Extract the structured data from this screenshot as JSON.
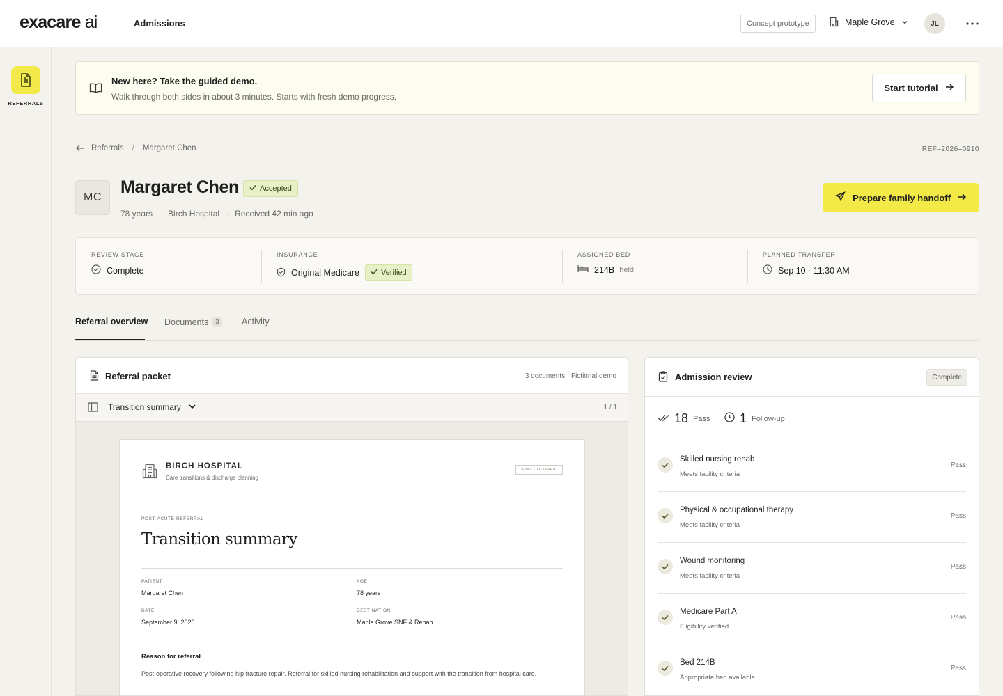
{
  "header": {
    "logo_main": "exacare",
    "logo_suffix": " ai",
    "section": "Admissions",
    "concept_label": "Concept prototype",
    "facility": "Maple Grove",
    "user_initials": "JL"
  },
  "sidebar": {
    "items": [
      {
        "label": "REFERRALS",
        "icon": "document-icon",
        "active": true
      }
    ],
    "accent": "#f2ea4a"
  },
  "banner": {
    "title": "New here? Take the guided demo.",
    "subtitle": "Walk through both sides in about 3 minutes. Starts with fresh demo progress.",
    "button": "Start tutorial"
  },
  "breadcrumb": {
    "parent": "Referrals",
    "separator": "/",
    "current": "Margaret Chen",
    "ref_id": "REF–2026–0910"
  },
  "patient": {
    "initials": "MC",
    "name": "Margaret Chen",
    "status": "Accepted",
    "age": "78 years",
    "source": "Birch Hospital",
    "received": "Received 42 min ago",
    "dot": "·",
    "primary_action": "Prepare family handoff"
  },
  "stats": {
    "review_stage": {
      "label": "REVIEW STAGE",
      "value": "Complete"
    },
    "insurance": {
      "label": "INSURANCE",
      "value": "Original Medicare",
      "badge": "Verified"
    },
    "bed": {
      "label": "ASSIGNED BED",
      "value": "214B",
      "note": "held"
    },
    "transfer": {
      "label": "PLANNED TRANSFER",
      "value": "Sep 10 · 11:30 AM"
    }
  },
  "tabs": [
    {
      "label": "Referral overview",
      "active": true
    },
    {
      "label": "Documents",
      "count": "3"
    },
    {
      "label": "Activity"
    }
  ],
  "packet": {
    "title": "Referral packet",
    "meta": "3 documents · Fictional demo",
    "selected_document": "Transition summary",
    "page": "1 / 1",
    "document": {
      "hospital": "BIRCH HOSPITAL",
      "hospital_sub": "Care transitions & discharge planning",
      "stamp": "DEMO DOCUMENT",
      "kicker": "POST-ACUTE REFERRAL",
      "title": "Transition summary",
      "fields": {
        "patient": {
          "label": "PATIENT",
          "value": "Margaret Chen"
        },
        "age": {
          "label": "AGE",
          "value": "78 years"
        },
        "date": {
          "label": "DATE",
          "value": "September 9, 2026"
        },
        "destination": {
          "label": "DESTINATION",
          "value": "Maple Grove SNF & Rehab"
        }
      },
      "reason_heading": "Reason for referral",
      "reason_text": "Post-operative recovery following hip fracture repair. Referral for skilled nursing rehabilitation and support with the transition from hospital care."
    }
  },
  "review": {
    "title": "Admission review",
    "status": "Complete",
    "pass_count": "18",
    "pass_label": "Pass",
    "followup_count": "1",
    "followup_label": "Follow-up",
    "criteria": [
      {
        "title": "Skilled nursing rehab",
        "detail": "Meets facility criteria",
        "result": "Pass"
      },
      {
        "title": "Physical & occupational therapy",
        "detail": "Meets facility criteria",
        "result": "Pass"
      },
      {
        "title": "Wound monitoring",
        "detail": "Meets facility criteria",
        "result": "Pass"
      },
      {
        "title": "Medicare Part A",
        "detail": "Eligibility verified",
        "result": "Pass"
      },
      {
        "title": "Bed 214B",
        "detail": "Appropriate bed available",
        "result": "Pass"
      }
    ]
  }
}
